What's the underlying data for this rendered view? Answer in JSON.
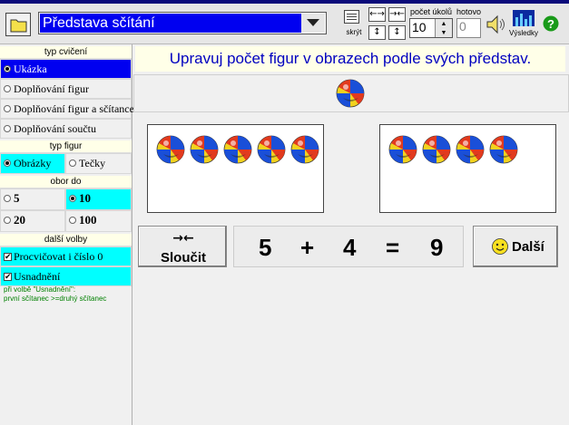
{
  "toolbar": {
    "title": "Představa sčítání",
    "hide_label": "skrýt",
    "task_count_label": "počet úkolů",
    "task_count_value": "10",
    "done_label": "hotovo",
    "done_value": "0",
    "results_label": "Výsledky",
    "arrows": [
      "←→",
      "→←",
      "↕",
      "↕"
    ],
    "spin_up": "▲",
    "spin_down": "▼",
    "icons": [
      "folder-icon",
      "chevron-down-icon",
      "list-icon",
      "speaker-icon",
      "chart-icon",
      "help-icon"
    ]
  },
  "left": {
    "exercise_type": {
      "header": "typ cvičení",
      "options": [
        "Ukázka",
        "Doplňování figur",
        "Doplňování figur a sčítance",
        "Doplňování součtu"
      ],
      "selected": "Ukázka"
    },
    "figure_type": {
      "header": "typ figur",
      "options": [
        "Obrázky",
        "Tečky"
      ],
      "selected": "Obrázky"
    },
    "range": {
      "header": "obor do",
      "options": [
        "5",
        "10",
        "20",
        "100"
      ],
      "selected": "10"
    },
    "more": {
      "header": "další volby",
      "options": [
        "Procvičovat i číslo 0",
        "Usnadnění"
      ],
      "check_mark": "✔"
    },
    "note_line1": "při volbě \"Usnadnění\":",
    "note_line2": "první sčítanec >=druhý sčítanec"
  },
  "main": {
    "instruction": "Upravuj počet figur v obrazech podle svých představ.",
    "left_count": 5,
    "right_count": 4,
    "merge_arrows": "→←",
    "merge_label": "Sloučit",
    "eq_a": "5",
    "eq_op": "+",
    "eq_b": "4",
    "eq_eq": "=",
    "eq_sum": "9",
    "next_label": "Další"
  },
  "colors": {
    "selected_bg": "#0000f0",
    "cyan": "#00ffff",
    "instruction_text": "#0000c0",
    "note_text": "#008000"
  }
}
